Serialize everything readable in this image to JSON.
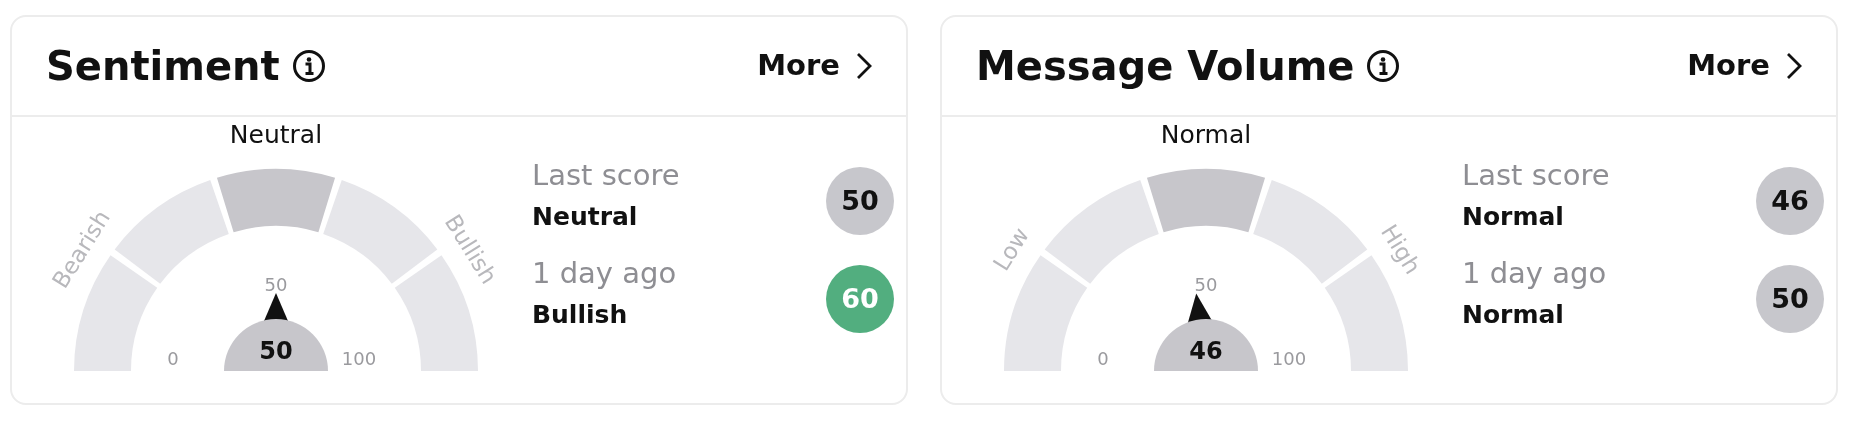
{
  "cards": [
    {
      "title": "Sentiment",
      "more": "More",
      "gauge": {
        "top_label": "Neutral",
        "left_label": "Bearish",
        "right_label": "Bullish",
        "tick_min": "0",
        "tick_mid": "50",
        "tick_max": "100",
        "value": "50",
        "segments": [
          {
            "selected": false
          },
          {
            "selected": false
          },
          {
            "selected": true
          },
          {
            "selected": false
          },
          {
            "selected": false
          }
        ]
      },
      "scores": [
        {
          "caption": "Last score",
          "label": "Neutral",
          "value": "50",
          "color": "#c7c7cc"
        },
        {
          "caption": "1 day ago",
          "label": "Bullish",
          "value": "60",
          "color": "#52ae7f"
        }
      ]
    },
    {
      "title": "Message Volume",
      "more": "More",
      "gauge": {
        "top_label": "Normal",
        "left_label": "Low",
        "right_label": "High",
        "tick_min": "0",
        "tick_mid": "50",
        "tick_max": "100",
        "value": "46",
        "segments": [
          {
            "selected": false
          },
          {
            "selected": false
          },
          {
            "selected": true
          },
          {
            "selected": false
          },
          {
            "selected": false
          }
        ]
      },
      "scores": [
        {
          "caption": "Last score",
          "label": "Normal",
          "value": "46",
          "color": "#c7c7cc"
        },
        {
          "caption": "1 day ago",
          "label": "Normal",
          "value": "50",
          "color": "#c7c7cc"
        }
      ]
    }
  ]
}
